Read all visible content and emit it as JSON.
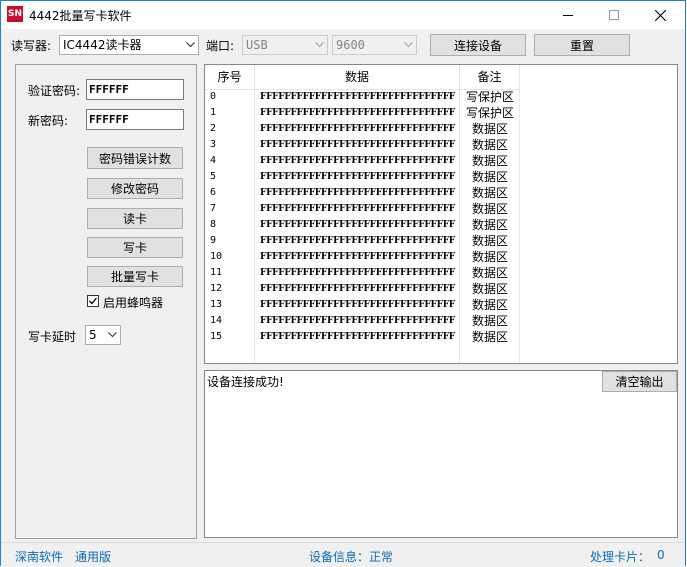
{
  "window": {
    "icon_text": "SN",
    "title": "4442批量写卡软件"
  },
  "toolbar": {
    "reader_label": "读写器:",
    "reader_value": "IC4442读卡器",
    "port_label": "端口:",
    "port_value": "USB",
    "baud_value": "9600",
    "connect_label": "连接设备",
    "reset_label": "重置"
  },
  "left": {
    "verify_label": "验证密码:",
    "verify_value": "FFFFFF",
    "newpwd_label": "新密码:",
    "newpwd_value": "FFFFFF",
    "buttons": {
      "error_count": "密码错误计数",
      "change_pwd": "修改密码",
      "read_card": "读卡",
      "write_card": "写卡",
      "batch_write": "批量写卡"
    },
    "buzzer_label": "启用蜂鸣器",
    "buzzer_checked": true,
    "delay_label": "写卡延时",
    "delay_value": "5"
  },
  "grid": {
    "headers": [
      "序号",
      "数据",
      "备注"
    ],
    "rows": [
      {
        "idx": "0",
        "data": "FFFFFFFFFFFFFFFFFFFFFFFFFFFFFFFF",
        "note": "写保护区"
      },
      {
        "idx": "1",
        "data": "FFFFFFFFFFFFFFFFFFFFFFFFFFFFFFFF",
        "note": "写保护区"
      },
      {
        "idx": "2",
        "data": "FFFFFFFFFFFFFFFFFFFFFFFFFFFFFFFF",
        "note": "数据区"
      },
      {
        "idx": "3",
        "data": "FFFFFFFFFFFFFFFFFFFFFFFFFFFFFFFF",
        "note": "数据区"
      },
      {
        "idx": "4",
        "data": "FFFFFFFFFFFFFFFFFFFFFFFFFFFFFFFF",
        "note": "数据区"
      },
      {
        "idx": "5",
        "data": "FFFFFFFFFFFFFFFFFFFFFFFFFFFFFFFF",
        "note": "数据区"
      },
      {
        "idx": "6",
        "data": "FFFFFFFFFFFFFFFFFFFFFFFFFFFFFFFF",
        "note": "数据区"
      },
      {
        "idx": "7",
        "data": "FFFFFFFFFFFFFFFFFFFFFFFFFFFFFFFF",
        "note": "数据区"
      },
      {
        "idx": "8",
        "data": "FFFFFFFFFFFFFFFFFFFFFFFFFFFFFFFF",
        "note": "数据区"
      },
      {
        "idx": "9",
        "data": "FFFFFFFFFFFFFFFFFFFFFFFFFFFFFFFF",
        "note": "数据区"
      },
      {
        "idx": "10",
        "data": "FFFFFFFFFFFFFFFFFFFFFFFFFFFFFFFF",
        "note": "数据区"
      },
      {
        "idx": "11",
        "data": "FFFFFFFFFFFFFFFFFFFFFFFFFFFFFFFF",
        "note": "数据区"
      },
      {
        "idx": "12",
        "data": "FFFFFFFFFFFFFFFFFFFFFFFFFFFFFFFF",
        "note": "数据区"
      },
      {
        "idx": "13",
        "data": "FFFFFFFFFFFFFFFFFFFFFFFFFFFFFFFF",
        "note": "数据区"
      },
      {
        "idx": "14",
        "data": "FFFFFFFFFFFFFFFFFFFFFFFFFFFFFFFF",
        "note": "数据区"
      },
      {
        "idx": "15",
        "data": "FFFFFFFFFFFFFFFFFFFFFFFFFFFFFFFF",
        "note": "数据区"
      }
    ]
  },
  "output": {
    "text": "设备连接成功!",
    "clear_label": "清空输出"
  },
  "status": {
    "company": "深南软件",
    "edition": "通用版",
    "device_info": "设备信息：正常",
    "processed": "处理卡片：",
    "processed_count": "0"
  },
  "colors": {
    "accent_border": "#1883d7",
    "status_text": "#0b6bb5",
    "icon_bg": "#c8102e"
  }
}
